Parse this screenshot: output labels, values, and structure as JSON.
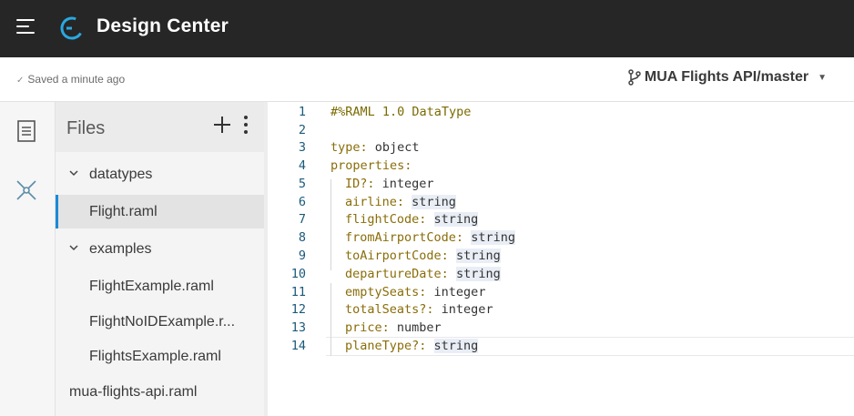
{
  "header": {
    "app_title": "Design Center",
    "menu_icon": "hamburger-menu-icon",
    "logo_icon": "design-center-logo-icon"
  },
  "subbar": {
    "saved_status": "Saved a minute ago",
    "project_branch": "MUA Flights API/master"
  },
  "files_panel": {
    "title": "Files",
    "tree": [
      {
        "label": "datatypes",
        "type": "folder",
        "expanded": true
      },
      {
        "label": "Flight.raml",
        "type": "file",
        "selected": true
      },
      {
        "label": "examples",
        "type": "folder",
        "expanded": true
      },
      {
        "label": "FlightExample.raml",
        "type": "file"
      },
      {
        "label": "FlightNoIDExample.r...",
        "type": "file"
      },
      {
        "label": "FlightsExample.raml",
        "type": "file"
      },
      {
        "label": "mua-flights-api.raml",
        "type": "file"
      }
    ]
  },
  "editor": {
    "lines": [
      {
        "n": "1",
        "text": "#%RAML 1.0 DataType"
      },
      {
        "n": "2",
        "text": ""
      },
      {
        "n": "3",
        "key": "type",
        "value": "object"
      },
      {
        "n": "4",
        "key": "properties",
        "value": ""
      },
      {
        "n": "5",
        "key": "ID?",
        "value": "integer"
      },
      {
        "n": "6",
        "key": "airline",
        "value": "string"
      },
      {
        "n": "7",
        "key": "flightCode",
        "value": "string"
      },
      {
        "n": "8",
        "key": "fromAirportCode",
        "value": "string"
      },
      {
        "n": "9",
        "key": "toAirportCode",
        "value": "string"
      },
      {
        "n": "10",
        "key": "departureDate",
        "value": "string"
      },
      {
        "n": "11",
        "key": "emptySeats",
        "value": "integer"
      },
      {
        "n": "12",
        "key": "totalSeats?",
        "value": "integer"
      },
      {
        "n": "13",
        "key": "price",
        "value": "number"
      },
      {
        "n": "14",
        "key": "planeType?",
        "value": "string"
      }
    ]
  },
  "colors": {
    "topbar": "#262626",
    "accent": "#1a8ad6",
    "yaml_key": "#8a6d08",
    "line_number": "#1a5a7a"
  }
}
